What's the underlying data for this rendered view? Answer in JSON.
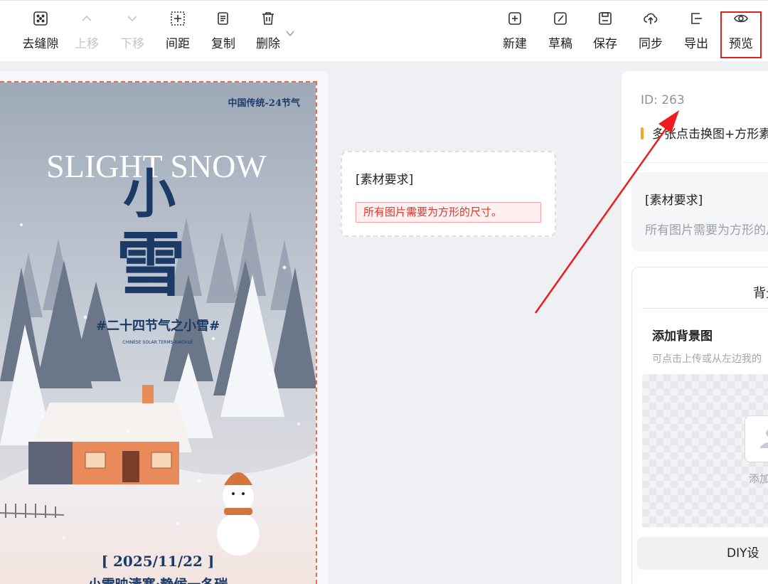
{
  "toolbar": {
    "left_buttons": [
      {
        "label": "去缝隙",
        "icon": "dice-icon",
        "enabled": true
      },
      {
        "label": "上移",
        "icon": "chevron-up-icon",
        "enabled": false
      },
      {
        "label": "下移",
        "icon": "chevron-down-icon",
        "enabled": false
      },
      {
        "label": "间距",
        "icon": "spacing-icon",
        "enabled": true
      },
      {
        "label": "复制",
        "icon": "copy-icon",
        "enabled": true
      },
      {
        "label": "删除",
        "icon": "trash-icon",
        "enabled": true
      }
    ],
    "right_buttons": [
      {
        "label": "新建",
        "icon": "plus-square-icon"
      },
      {
        "label": "草稿",
        "icon": "draft-icon"
      },
      {
        "label": "保存",
        "icon": "save-icon"
      },
      {
        "label": "同步",
        "icon": "cloud-sync-icon"
      },
      {
        "label": "导出",
        "icon": "export-icon"
      },
      {
        "label": "预览",
        "icon": "eye-icon",
        "highlighted": true
      }
    ],
    "highlight_color": "#e0221d"
  },
  "poster": {
    "top_text": "中国传统-24节气",
    "english_title": "SLIGHT SNOW",
    "char1": "小",
    "char2": "雪",
    "tagline": "#二十四节气之小雪#",
    "tagline_en": "CHINESE SOLAR TERMS-XIAOXUE",
    "date": "[ 2025/11/22 ]",
    "verse": "小雪映清寒·静候一冬瑞"
  },
  "material_card": {
    "title": "[素材要求]",
    "warning": "所有图片需要为方形的尺寸。"
  },
  "right_panel": {
    "id_text": "ID: 263",
    "tip": "多张点击换图+方形素材",
    "material_title": "[素材要求]",
    "material_sub": "所有图片需要为方形的尺寸",
    "bg_section_title": "背景",
    "add_bg_title": "添加背景图",
    "add_bg_sub": "可点击上传或从左边我的",
    "upload_label": "添加",
    "diy_button": "DIY设"
  }
}
